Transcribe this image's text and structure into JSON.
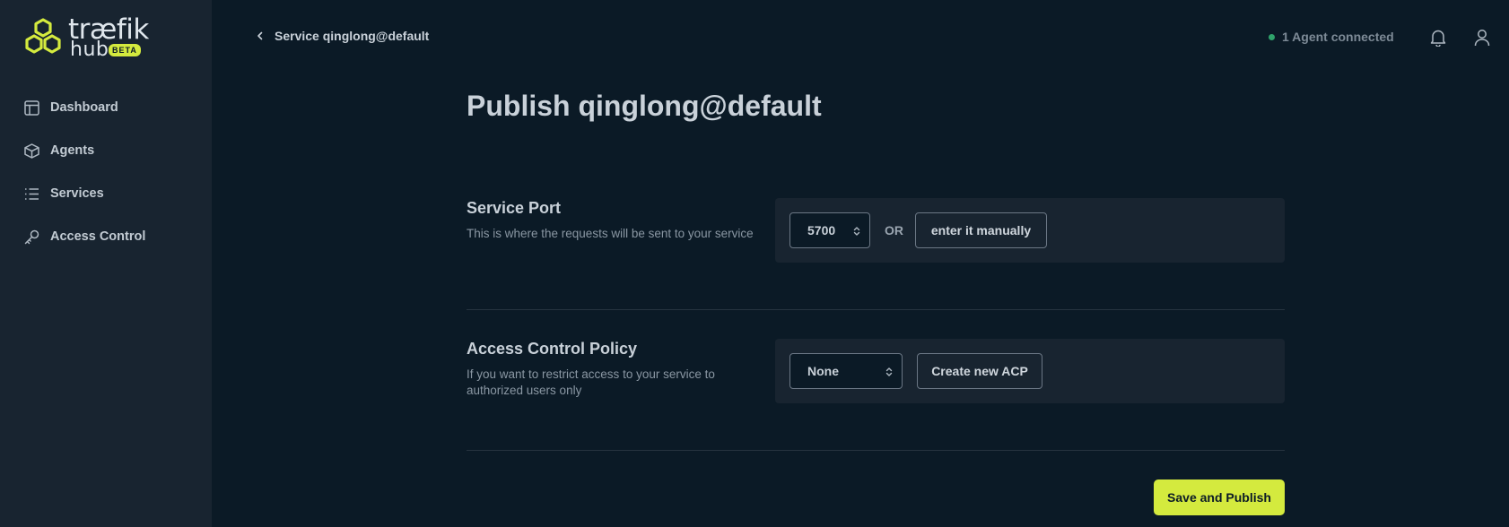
{
  "brand": {
    "name_line1": "træfik",
    "name_line2": "hub",
    "badge": "BETA",
    "accent_color": "#d4ea3e"
  },
  "sidebar": {
    "items": [
      {
        "label": "Dashboard",
        "icon": "dashboard-icon"
      },
      {
        "label": "Agents",
        "icon": "cube-icon"
      },
      {
        "label": "Services",
        "icon": "list-icon"
      },
      {
        "label": "Access Control",
        "icon": "key-icon"
      }
    ]
  },
  "header": {
    "back_label": "Service qinglong@default",
    "agent_status": "1 Agent connected",
    "agent_status_color": "#2fa36b"
  },
  "main": {
    "title": "Publish qinglong@default",
    "service_port": {
      "title": "Service Port",
      "description": "This is where the requests will be sent to your service",
      "selected_port": "5700",
      "or_label": "OR",
      "manual_button": "enter it manually"
    },
    "access_control": {
      "title": "Access Control Policy",
      "description": "If you want to restrict access to your service to authorized users only",
      "selected_policy": "None",
      "create_button": "Create new ACP"
    },
    "save_button": "Save and Publish"
  }
}
